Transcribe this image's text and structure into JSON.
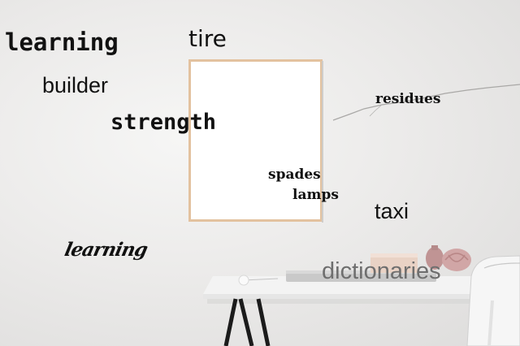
{
  "scene": {
    "description_words": [
      "learning",
      "tire",
      "builder",
      "strength",
      "residues",
      "spades",
      "lamps",
      "taxi",
      "learning",
      "dictionaries"
    ]
  },
  "words": {
    "learning_1": "learning",
    "tire": "tire",
    "builder": "builder",
    "strength": "strength",
    "residues": "residues",
    "spades": "spades",
    "lamps": "lamps",
    "taxi": "taxi",
    "learning_2": "learning",
    "dictionaries": "dictionaries"
  },
  "colors": {
    "wall": "#ecebea",
    "frame": "#e3c29f",
    "canvas": "#ffffff",
    "desk_top": "#f2f2f2",
    "desk_legs": "#1b1b1b",
    "vase": "#c89a9a",
    "text": "#111111"
  }
}
